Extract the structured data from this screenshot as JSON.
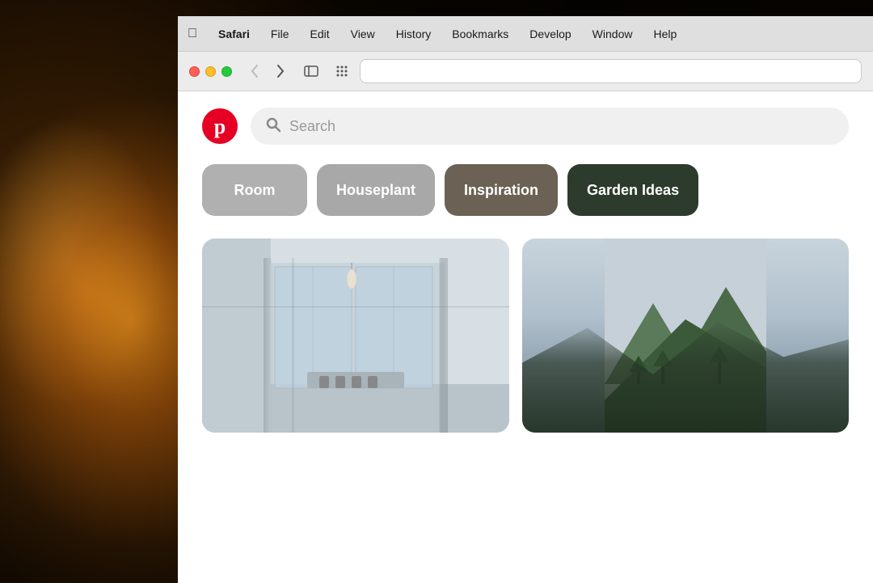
{
  "background": {
    "description": "Warm bokeh background with Edison lamp"
  },
  "macos": {
    "menubar": {
      "apple": "⌘",
      "items": [
        {
          "label": "Safari",
          "bold": true
        },
        {
          "label": "File"
        },
        {
          "label": "Edit"
        },
        {
          "label": "View"
        },
        {
          "label": "History"
        },
        {
          "label": "Bookmarks"
        },
        {
          "label": "Develop"
        },
        {
          "label": "Window"
        },
        {
          "label": "Help"
        }
      ]
    }
  },
  "browser": {
    "toolbar": {
      "back_button": "‹",
      "forward_button": "›",
      "sidebar_button": "⊞",
      "grid_button": "⠿",
      "address_bar": {
        "value": "",
        "placeholder": ""
      }
    }
  },
  "pinterest": {
    "logo_letter": "p",
    "search_placeholder": "Search",
    "categories": [
      {
        "label": "Room",
        "color_class": "pill-room"
      },
      {
        "label": "Houseplant",
        "color_class": "pill-houseplant"
      },
      {
        "label": "Inspiration",
        "color_class": "pill-inspiration"
      },
      {
        "label": "Garden Ideas",
        "color_class": "pill-garden"
      }
    ],
    "pin_alt_1": "Modern open plan kitchen with bi-fold doors",
    "pin_alt_2": "Mountain landscape with trees"
  }
}
